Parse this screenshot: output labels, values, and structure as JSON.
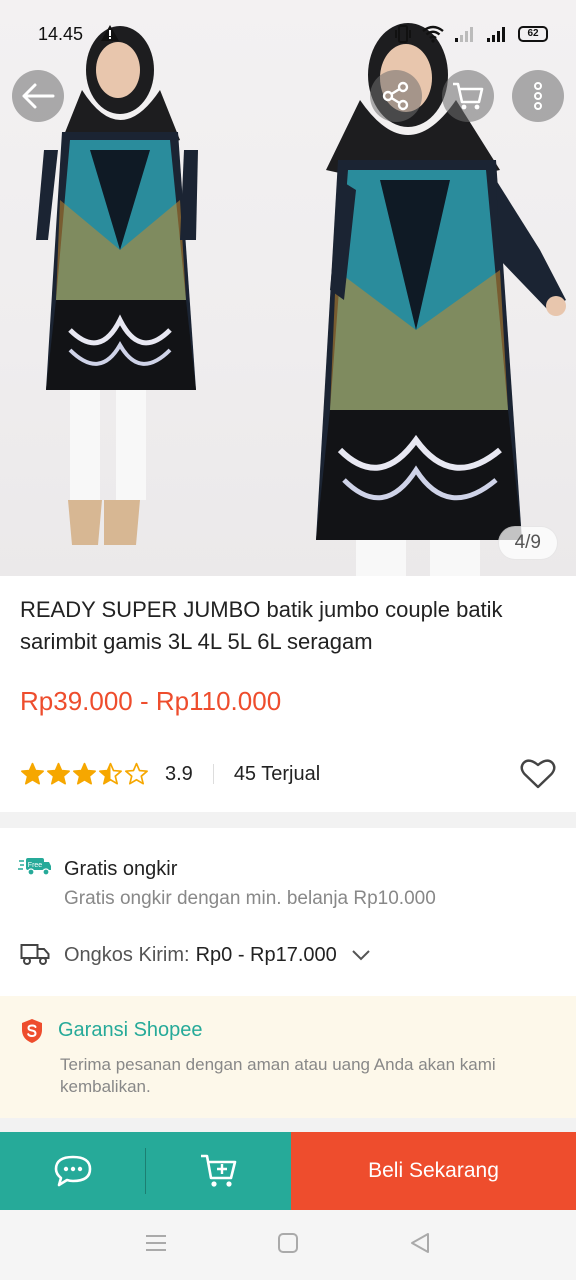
{
  "status_bar": {
    "time": "14.45",
    "battery": "62"
  },
  "image_gallery": {
    "counter": "4/9"
  },
  "product": {
    "title": "READY SUPER JUMBO batik jumbo couple batik sarimbit gamis 3L 4L 5L 6L seragam",
    "price": "Rp39.000 - Rp110.000",
    "rating": 3.5,
    "rating_value": "3.9",
    "sold": "45 Terjual"
  },
  "shipping": {
    "free_badge": "Free",
    "title": "Gratis ongkir",
    "subtitle": "Gratis ongkir dengan min. belanja Rp10.000",
    "cost_label": "Ongkos Kirim:",
    "cost_value": "Rp0 - Rp17.000"
  },
  "guarantee": {
    "title": "Garansi Shopee",
    "description": "Terima pesanan dengan aman atau uang Anda akan kami kembalikan."
  },
  "action_bar": {
    "buy_label": "Beli Sekarang"
  },
  "colors": {
    "brand": "#ee4d2d",
    "accent": "#26aa99",
    "star": "#f6a700",
    "guarantee_bg": "#fdf8ea"
  },
  "icons": [
    "back-arrow-icon",
    "share-icon",
    "cart-icon",
    "more-vertical-icon",
    "star-icon",
    "heart-icon",
    "free-shipping-icon",
    "truck-icon",
    "chevron-down-icon",
    "shopee-guarantee-icon",
    "chat-icon",
    "add-to-cart-icon",
    "nav-menu-icon",
    "nav-home-icon",
    "nav-back-icon"
  ]
}
